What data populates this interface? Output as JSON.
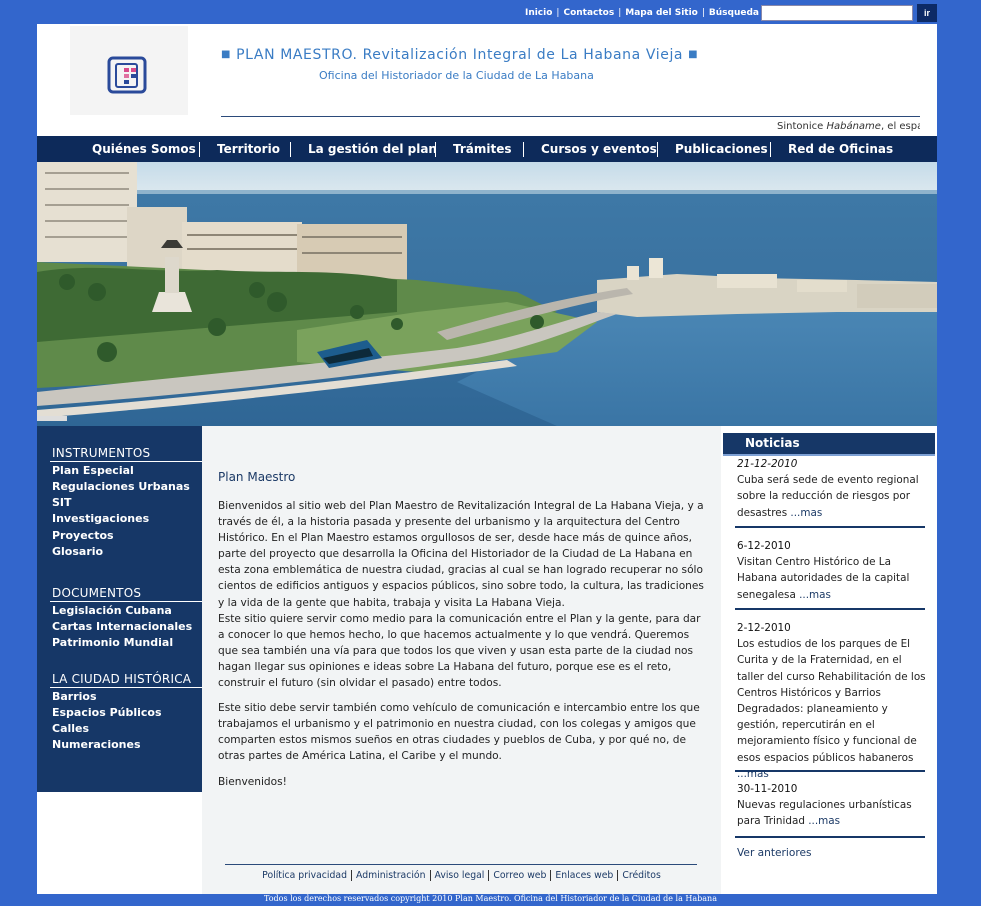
{
  "topbar": {
    "links": [
      "Inicio",
      "Contactos",
      "Mapa del Sitio"
    ],
    "search_label": "Búsqueda",
    "search_value": "",
    "go_label": "ir"
  },
  "header": {
    "title": "PLAN MAESTRO. Revitalización Integral de La Habana Vieja",
    "title_marker": "■",
    "subtitle": "Oficina del Historiador de la Ciudad de La Habana",
    "ticker_prefix": "Sintonice ",
    "ticker_station": "Habáname",
    "ticker_suffix": ", el espa"
  },
  "nav": {
    "items": [
      "Quiénes Somos",
      "Territorio",
      "La gestión del plan",
      "Trámites",
      "Cursos y eventos",
      "Publicaciones",
      "Red de Oficinas"
    ]
  },
  "sidebar": {
    "sections": [
      {
        "title": "INSTRUMENTOS",
        "items": [
          "Plan Especial",
          "Regulaciones Urbanas",
          "SIT",
          "Investigaciones",
          "Proyectos",
          "Glosario"
        ]
      },
      {
        "title": "DOCUMENTOS",
        "items": [
          "Legislación Cubana",
          "Cartas Internacionales",
          "Patrimonio Mundial"
        ]
      },
      {
        "title": "LA CIUDAD HISTÓRICA",
        "items": [
          "Barrios",
          "Espacios Públicos",
          "Calles",
          "Numeraciones"
        ]
      }
    ]
  },
  "content": {
    "title": "Plan Maestro",
    "paragraphs": [
      "Bienvenidos al sitio web del Plan Maestro de Revitalización Integral de La Habana Vieja, y a través de él, a la historia pasada y presente del urbanismo y la arquitectura del Centro Histórico. En el Plan Maestro estamos orgullosos de ser, desde hace más de quince años, parte del proyecto que desarrolla la Oficina del Historiador de la Ciudad de La Habana en esta zona emblemática de nuestra ciudad, gracias al cual se han logrado recuperar no sólo cientos de edificios antiguos y espacios públicos, sino sobre todo, la cultura, las tradiciones y la vida de la gente que habita, trabaja y visita La Habana Vieja.",
      "Este sitio quiere servir como medio para la comunicación entre el Plan y la gente, para dar a conocer lo que hemos hecho, lo que hacemos actualmente y lo que vendrá. Queremos que sea también una vía para que todos los que viven y usan esta parte de la ciudad nos hagan llegar sus opiniones e ideas sobre La Habana del futuro, porque ese es el reto, construir el futuro (sin olvidar el pasado) entre todos.",
      "Este sitio debe servir también como vehículo de comunicación e intercambio entre los que trabajamos el urbanismo y el patrimonio en nuestra ciudad, con los colegas y amigos que comparten estos mismos sueños en otras ciudades y pueblos de Cuba, y por qué no, de otras partes de América Latina, el Caribe y el mundo.",
      "Bienvenidos!"
    ]
  },
  "footer": {
    "links": [
      "Política privacidad",
      "Administración",
      "Aviso  legal",
      "Correo web",
      "Enlaces web",
      "Créditos"
    ],
    "copyright": "Todos los derechos reservados copyright 2010 Plan Maestro. Oficina del Historiador de la Ciudad de la Habana"
  },
  "news": {
    "title": "Noticias",
    "items": [
      {
        "date": "21-12-2010",
        "text": "Cuba será sede de evento regional sobre la reducción de riesgos por desastres",
        "more": "...mas"
      },
      {
        "date": "6-12-2010",
        "text": "Visitan Centro Histórico de La Habana autoridades de la capital senegalesa",
        "more": "...mas"
      },
      {
        "date": "2-12-2010",
        "text": "Los estudios de los parques de El Curita y de la Fraternidad, en el taller del curso Rehabilitación de los Centros Históricos y Barrios Degradados: planeamiento y gestión, repercutirán en el mejoramiento físico y funcional de esos espacios públicos habaneros",
        "more": "...mas"
      },
      {
        "date": "30-11-2010",
        "text": "Nuevas regulaciones urbanísticas para Trinidad",
        "more": "...mas"
      }
    ],
    "archive_label": "Ver anteriores"
  },
  "colors": {
    "background": "#3366cc",
    "navy": "#163767",
    "nav_bar": "#0d2a5a",
    "title_blue": "#3a7cc4",
    "content_bg": "#f2f4f5"
  }
}
